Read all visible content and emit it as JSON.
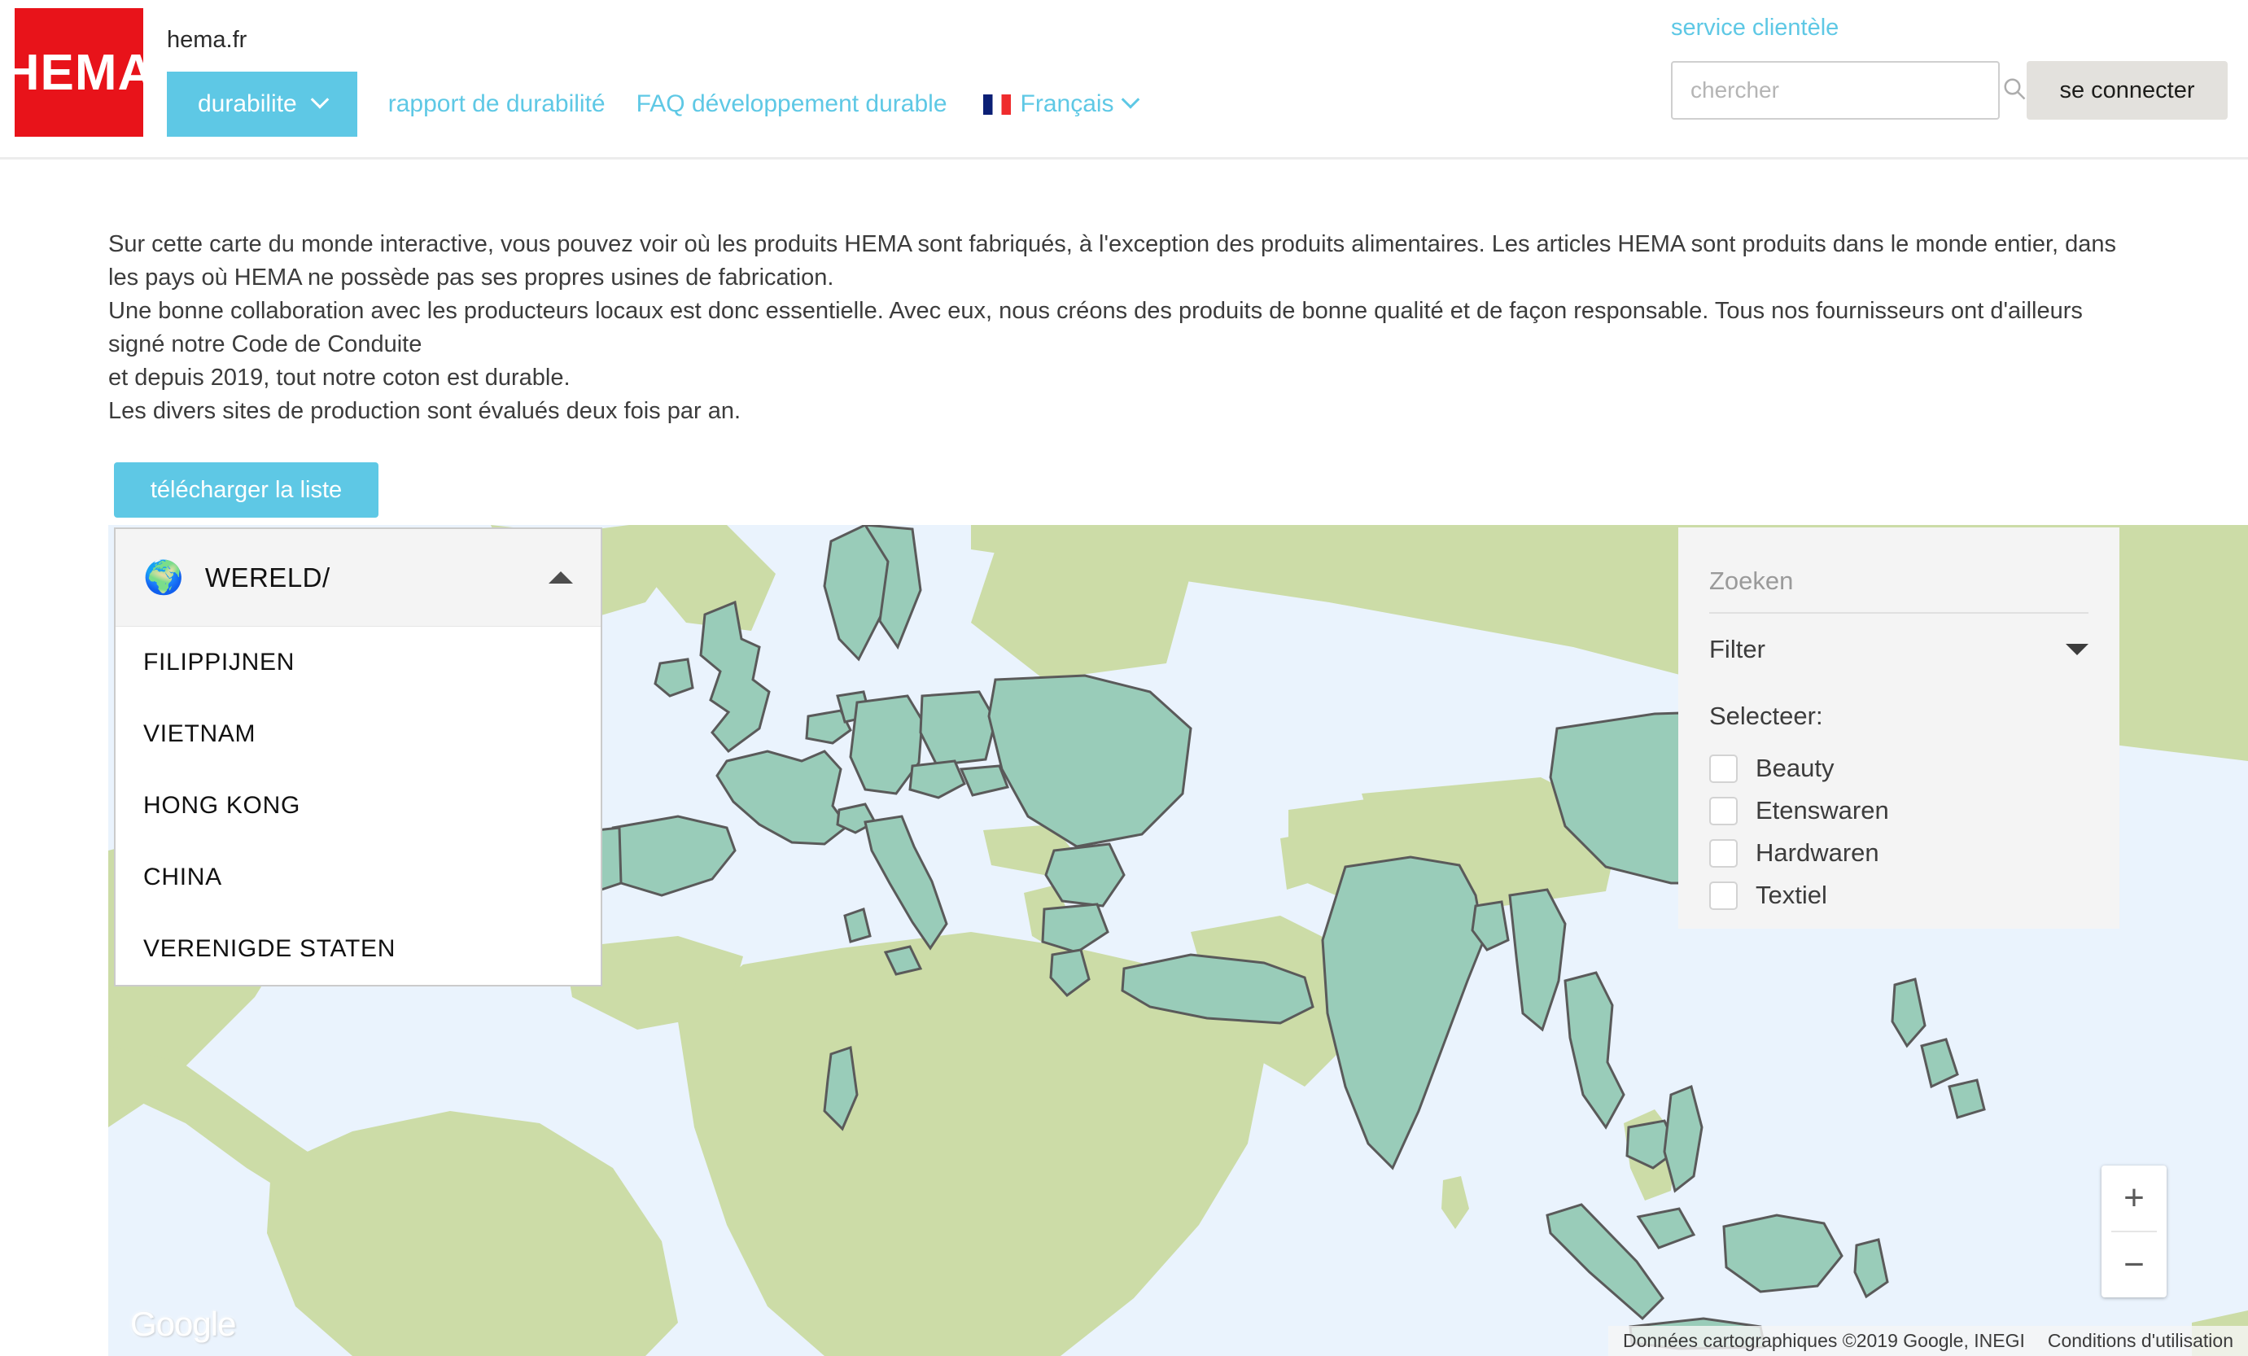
{
  "header": {
    "logo_text": "HEMA",
    "site_name": "hema.fr",
    "nav": {
      "primary_label": "durabilite",
      "links": [
        {
          "label": "rapport de durabilité"
        },
        {
          "label": "FAQ développement durable"
        }
      ],
      "language": "Français",
      "flag_icon": "flag-france-icon"
    },
    "service_link": "service clientèle",
    "search": {
      "placeholder": "chercher",
      "value": "",
      "icon": "search-icon"
    },
    "login_label": "se connecter"
  },
  "intro": {
    "lines": [
      "Sur cette carte du monde interactive, vous pouvez voir où les produits HEMA sont fabriqués, à l'exception des produits alimentaires. Les articles HEMA sont produits dans le monde entier, dans les pays où HEMA ne possède pas ses propres usines de fabrication.",
      "Une bonne collaboration avec les producteurs locaux est donc essentielle. Avec eux, nous créons des produits de bonne qualité et de façon responsable. Tous nos fournisseurs ont d'ailleurs signé notre Code de Conduite",
      "et depuis 2019, tout notre coton est durable.",
      "Les divers sites de production sont évalués deux fois par an."
    ]
  },
  "download_button": {
    "label": "télécharger la liste"
  },
  "country_panel": {
    "header_label": "WERELD/",
    "header_icon": "globe-icon",
    "expanded": true,
    "caret_icon": "caret-up-icon",
    "items": [
      {
        "label": "FILIPPIJNEN"
      },
      {
        "label": "VIETNAM"
      },
      {
        "label": "HONG KONG"
      },
      {
        "label": "CHINA"
      },
      {
        "label": "VERENIGDE STATEN"
      }
    ]
  },
  "filter_panel": {
    "search_placeholder": "Zoeken",
    "search_value": "",
    "filter_label": "Filter",
    "filter_caret_icon": "caret-down-icon",
    "select_label": "Selecteer:",
    "checkboxes": [
      {
        "label": "Beauty",
        "checked": false
      },
      {
        "label": "Etenswaren",
        "checked": false
      },
      {
        "label": "Hardwaren",
        "checked": false
      },
      {
        "label": "Textiel",
        "checked": false
      }
    ]
  },
  "map": {
    "provider_logo": "Google",
    "attribution": "Données cartographiques ©2019 Google, INEGI",
    "terms_label": "Conditions d'utilisation",
    "zoom_in_label": "+",
    "zoom_out_label": "−",
    "colors": {
      "water": "#eaf3fd",
      "land": "#ccdca7",
      "highlight": "#99ccb9",
      "border": "#5a5a5a"
    }
  },
  "theme": {
    "brand_red": "#e8131a",
    "accent_cyan": "#5ec8e5",
    "button_grey": "#e3e1dd",
    "text_dark": "#3c3c3c"
  }
}
